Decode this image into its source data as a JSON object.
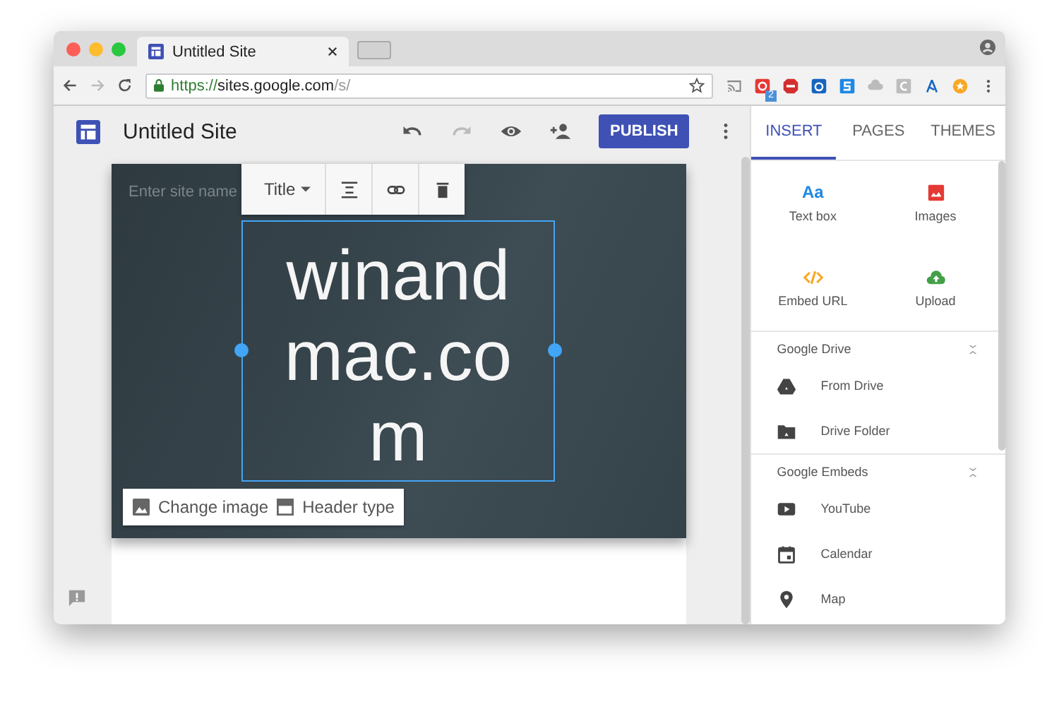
{
  "browser": {
    "tab_title": "Untitled Site",
    "url_scheme": "https://",
    "url_host": "sites.google.com",
    "url_path": "/s/",
    "extension_badge": "2"
  },
  "app": {
    "title": "Untitled Site",
    "publish": "PUBLISH"
  },
  "header": {
    "site_name_placeholder": "Enter site name",
    "style_dropdown": "Title",
    "title_text": "winandmac.com",
    "buttons": [
      {
        "label": "Change image",
        "kind": "image"
      },
      {
        "label": "Header type",
        "kind": "header"
      }
    ]
  },
  "panel": {
    "tabs": [
      {
        "label": "INSERT",
        "selected": true
      },
      {
        "label": "PAGES",
        "selected": false
      },
      {
        "label": "THEMES",
        "selected": false
      }
    ],
    "insert_items": [
      {
        "label": "Text box",
        "kind": "text",
        "icon_text": "Aa"
      },
      {
        "label": "Images",
        "kind": "images"
      },
      {
        "label": "Embed URL",
        "kind": "embed"
      },
      {
        "label": "Upload",
        "kind": "upload"
      }
    ],
    "sections": [
      {
        "title": "Google Drive",
        "items": [
          {
            "label": "From Drive",
            "kind": "drive"
          },
          {
            "label": "Drive Folder",
            "kind": "folder"
          }
        ]
      },
      {
        "title": "Google Embeds",
        "items": [
          {
            "label": "YouTube",
            "kind": "youtube"
          },
          {
            "label": "Calendar",
            "kind": "calendar"
          },
          {
            "label": "Map",
            "kind": "map"
          }
        ]
      }
    ]
  }
}
